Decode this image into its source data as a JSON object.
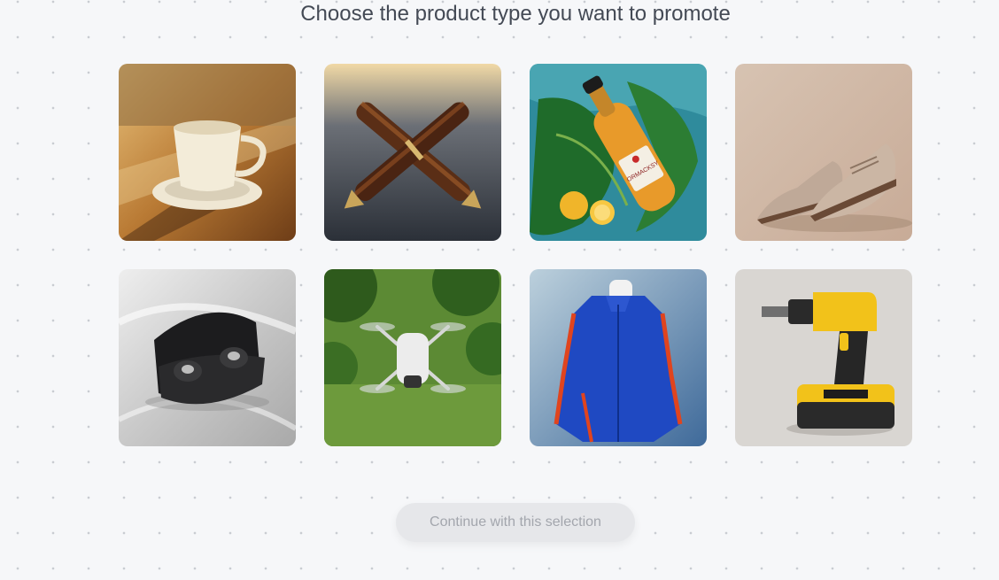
{
  "header": {
    "title": "Choose the product type you want to promote"
  },
  "products": [
    {
      "name": "coffee-cup"
    },
    {
      "name": "fountain-pens"
    },
    {
      "name": "sparkling-bottle",
      "label_text": "ORMACKSY"
    },
    {
      "name": "leather-shoes"
    },
    {
      "name": "earbuds"
    },
    {
      "name": "drone"
    },
    {
      "name": "jacket"
    },
    {
      "name": "power-drill"
    }
  ],
  "footer": {
    "continue_label": "Continue with this selection",
    "enabled": false
  }
}
